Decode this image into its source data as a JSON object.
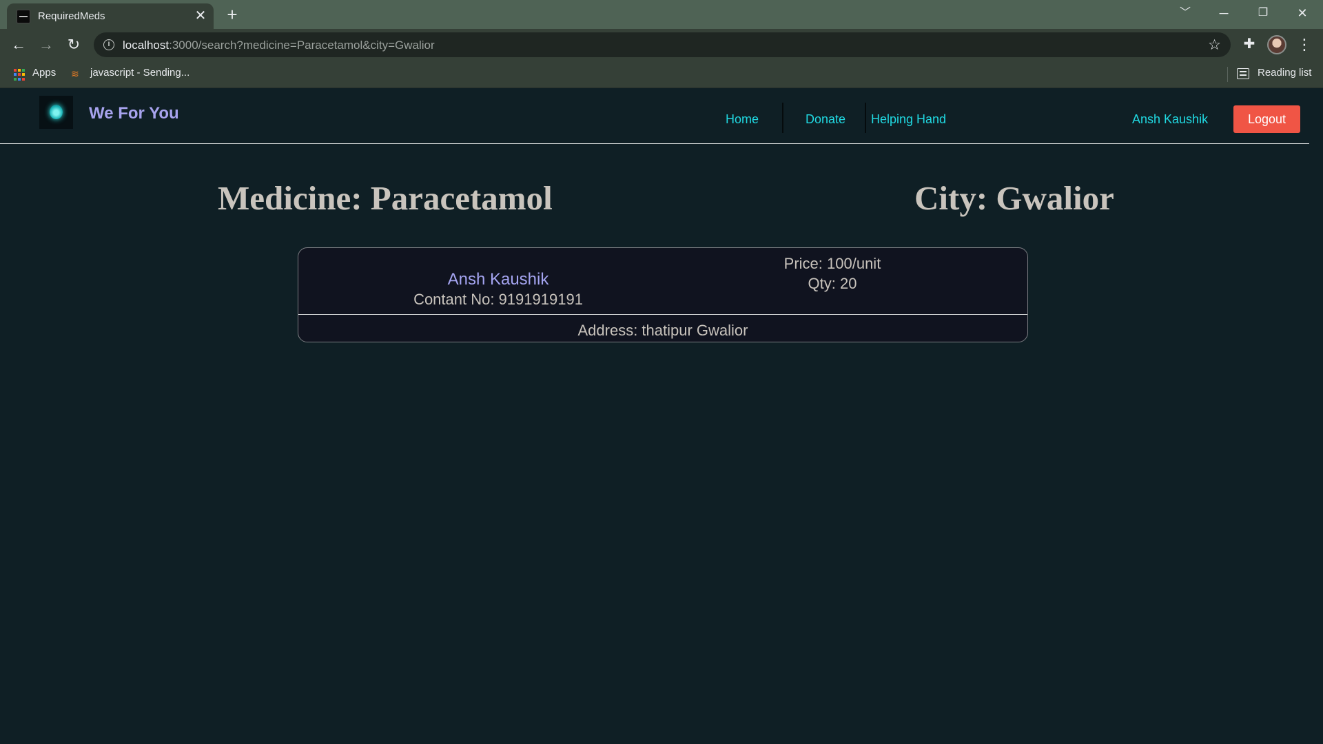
{
  "browser": {
    "tab_title": "RequiredMeds",
    "tab_close": "✕",
    "new_tab": "+",
    "url_host": "localhost",
    "url_rest": ":3000/search?medicine=Paracetamol&city=Gwalior",
    "bookmarks": {
      "apps_label": "Apps",
      "item1_label": "javascript - Sending...",
      "reading_list_label": "Reading list"
    },
    "colors": {
      "tab_strip": "#4f6355",
      "toolbar": "#354037"
    }
  },
  "site": {
    "brand": "We For You",
    "nav": {
      "home": "Home",
      "donate": "Donate",
      "helping_hand": "Helping Hand",
      "user_name": "Ansh Kaushik",
      "logout": "Logout"
    },
    "search": {
      "medicine_heading": "Medicine: Paracetamol",
      "city_heading": "City: Gwalior"
    },
    "results": [
      {
        "donor_name": "Ansh Kaushik",
        "contact": "Contant No: 9191919191",
        "price": "Price: 100/unit",
        "qty": "Qty: 20",
        "address": "Address: thatipur Gwalior"
      }
    ],
    "colors": {
      "background": "#0f1f25",
      "brand": "#a7a3ee",
      "nav_link": "#20d9e2",
      "logout_bg": "#f05545",
      "card_bg": "#10131f"
    }
  }
}
